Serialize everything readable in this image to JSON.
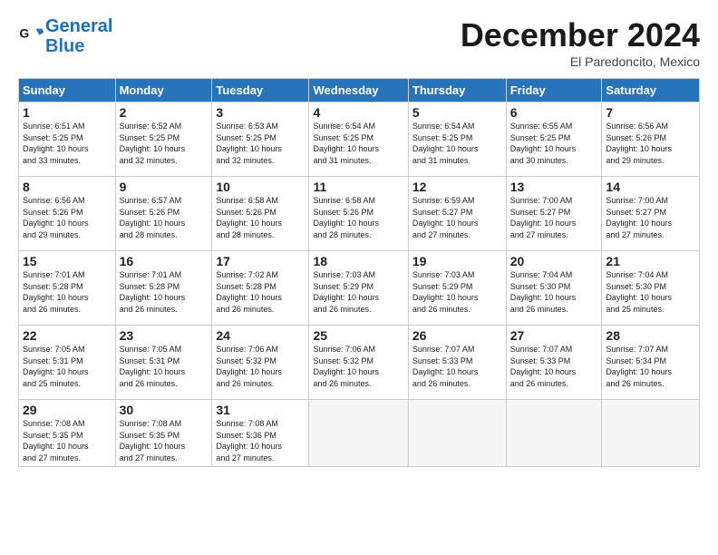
{
  "header": {
    "logo_line1": "General",
    "logo_line2": "Blue",
    "month": "December 2024",
    "location": "El Paredoncito, Mexico"
  },
  "weekdays": [
    "Sunday",
    "Monday",
    "Tuesday",
    "Wednesday",
    "Thursday",
    "Friday",
    "Saturday"
  ],
  "weeks": [
    [
      {
        "day": "1",
        "info": "Sunrise: 6:51 AM\nSunset: 5:25 PM\nDaylight: 10 hours\nand 33 minutes."
      },
      {
        "day": "2",
        "info": "Sunrise: 6:52 AM\nSunset: 5:25 PM\nDaylight: 10 hours\nand 32 minutes."
      },
      {
        "day": "3",
        "info": "Sunrise: 6:53 AM\nSunset: 5:25 PM\nDaylight: 10 hours\nand 32 minutes."
      },
      {
        "day": "4",
        "info": "Sunrise: 6:54 AM\nSunset: 5:25 PM\nDaylight: 10 hours\nand 31 minutes."
      },
      {
        "day": "5",
        "info": "Sunrise: 6:54 AM\nSunset: 5:25 PM\nDaylight: 10 hours\nand 31 minutes."
      },
      {
        "day": "6",
        "info": "Sunrise: 6:55 AM\nSunset: 5:25 PM\nDaylight: 10 hours\nand 30 minutes."
      },
      {
        "day": "7",
        "info": "Sunrise: 6:56 AM\nSunset: 5:26 PM\nDaylight: 10 hours\nand 29 minutes."
      }
    ],
    [
      {
        "day": "8",
        "info": "Sunrise: 6:56 AM\nSunset: 5:26 PM\nDaylight: 10 hours\nand 29 minutes."
      },
      {
        "day": "9",
        "info": "Sunrise: 6:57 AM\nSunset: 5:26 PM\nDaylight: 10 hours\nand 28 minutes."
      },
      {
        "day": "10",
        "info": "Sunrise: 6:58 AM\nSunset: 5:26 PM\nDaylight: 10 hours\nand 28 minutes."
      },
      {
        "day": "11",
        "info": "Sunrise: 6:58 AM\nSunset: 5:26 PM\nDaylight: 10 hours\nand 28 minutes."
      },
      {
        "day": "12",
        "info": "Sunrise: 6:59 AM\nSunset: 5:27 PM\nDaylight: 10 hours\nand 27 minutes."
      },
      {
        "day": "13",
        "info": "Sunrise: 7:00 AM\nSunset: 5:27 PM\nDaylight: 10 hours\nand 27 minutes."
      },
      {
        "day": "14",
        "info": "Sunrise: 7:00 AM\nSunset: 5:27 PM\nDaylight: 10 hours\nand 27 minutes."
      }
    ],
    [
      {
        "day": "15",
        "info": "Sunrise: 7:01 AM\nSunset: 5:28 PM\nDaylight: 10 hours\nand 26 minutes."
      },
      {
        "day": "16",
        "info": "Sunrise: 7:01 AM\nSunset: 5:28 PM\nDaylight: 10 hours\nand 26 minutes."
      },
      {
        "day": "17",
        "info": "Sunrise: 7:02 AM\nSunset: 5:28 PM\nDaylight: 10 hours\nand 26 minutes."
      },
      {
        "day": "18",
        "info": "Sunrise: 7:03 AM\nSunset: 5:29 PM\nDaylight: 10 hours\nand 26 minutes."
      },
      {
        "day": "19",
        "info": "Sunrise: 7:03 AM\nSunset: 5:29 PM\nDaylight: 10 hours\nand 26 minutes."
      },
      {
        "day": "20",
        "info": "Sunrise: 7:04 AM\nSunset: 5:30 PM\nDaylight: 10 hours\nand 26 minutes."
      },
      {
        "day": "21",
        "info": "Sunrise: 7:04 AM\nSunset: 5:30 PM\nDaylight: 10 hours\nand 25 minutes."
      }
    ],
    [
      {
        "day": "22",
        "info": "Sunrise: 7:05 AM\nSunset: 5:31 PM\nDaylight: 10 hours\nand 25 minutes."
      },
      {
        "day": "23",
        "info": "Sunrise: 7:05 AM\nSunset: 5:31 PM\nDaylight: 10 hours\nand 26 minutes."
      },
      {
        "day": "24",
        "info": "Sunrise: 7:06 AM\nSunset: 5:32 PM\nDaylight: 10 hours\nand 26 minutes."
      },
      {
        "day": "25",
        "info": "Sunrise: 7:06 AM\nSunset: 5:32 PM\nDaylight: 10 hours\nand 26 minutes."
      },
      {
        "day": "26",
        "info": "Sunrise: 7:07 AM\nSunset: 5:33 PM\nDaylight: 10 hours\nand 26 minutes."
      },
      {
        "day": "27",
        "info": "Sunrise: 7:07 AM\nSunset: 5:33 PM\nDaylight: 10 hours\nand 26 minutes."
      },
      {
        "day": "28",
        "info": "Sunrise: 7:07 AM\nSunset: 5:34 PM\nDaylight: 10 hours\nand 26 minutes."
      }
    ],
    [
      {
        "day": "29",
        "info": "Sunrise: 7:08 AM\nSunset: 5:35 PM\nDaylight: 10 hours\nand 27 minutes."
      },
      {
        "day": "30",
        "info": "Sunrise: 7:08 AM\nSunset: 5:35 PM\nDaylight: 10 hours\nand 27 minutes."
      },
      {
        "day": "31",
        "info": "Sunrise: 7:08 AM\nSunset: 5:36 PM\nDaylight: 10 hours\nand 27 minutes."
      },
      {
        "day": "",
        "info": ""
      },
      {
        "day": "",
        "info": ""
      },
      {
        "day": "",
        "info": ""
      },
      {
        "day": "",
        "info": ""
      }
    ]
  ]
}
